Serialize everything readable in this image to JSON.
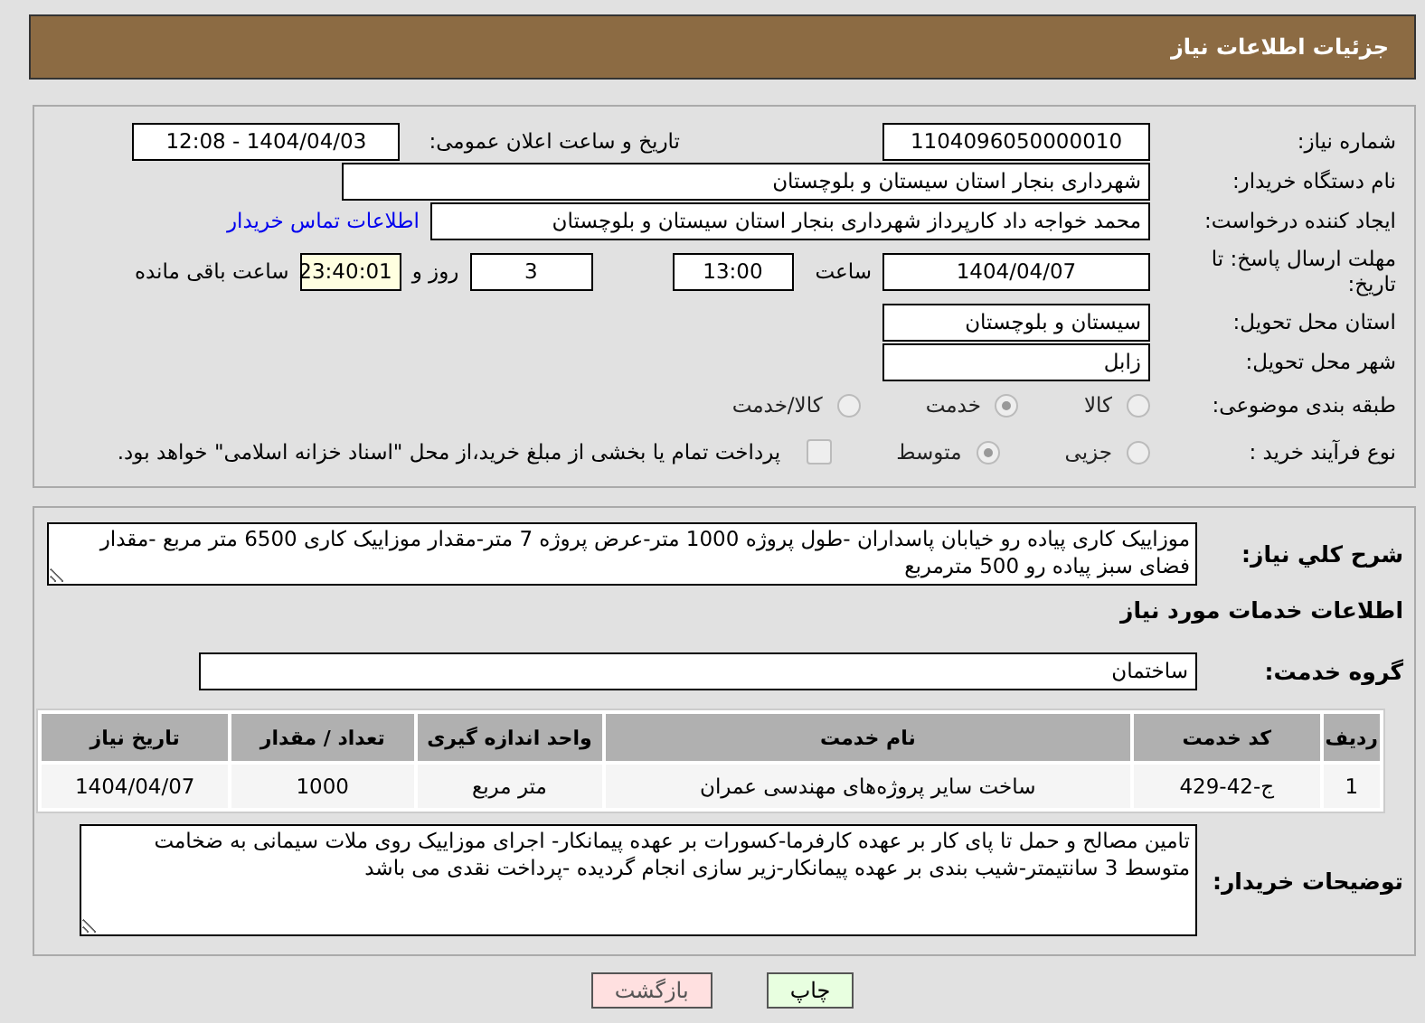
{
  "header": {
    "title": "جزئیات اطلاعات نیاز"
  },
  "need_number": {
    "label": "شماره نیاز:",
    "value": "1104096050000010"
  },
  "announce": {
    "label": "تاریخ و ساعت اعلان عمومی:",
    "value": "1404/04/03 - 12:08"
  },
  "buyer": {
    "label": "نام دستگاه خریدار:",
    "value": "شهرداری بنجار استان سیستان و بلوچستان"
  },
  "requester": {
    "label": "ایجاد کننده درخواست:",
    "value": "محمد خواجه داد کارپرداز شهرداری بنجار استان سیستان و بلوچستان",
    "link": "اطلاعات تماس خریدار"
  },
  "deadline": {
    "label": "مهلت ارسال پاسخ: تا تاریخ:",
    "date": "1404/04/07",
    "time_label": "ساعت",
    "time": "13:00",
    "days": "3",
    "days_label": "روز و",
    "remaining": "23:40:01",
    "remaining_label": "ساعت باقی مانده"
  },
  "province": {
    "label": "استان محل تحویل:",
    "value": "سیستان و بلوچستان"
  },
  "city": {
    "label": "شهر محل تحویل:",
    "value": "زابل"
  },
  "category": {
    "label": "طبقه بندی موضوعی:",
    "options": [
      {
        "label": "کالا",
        "selected": false
      },
      {
        "label": "خدمت",
        "selected": true
      },
      {
        "label": "کالا/خدمت",
        "selected": false
      }
    ]
  },
  "process": {
    "label": "نوع فرآیند خرید :",
    "options": [
      {
        "label": "جزیی",
        "selected": false
      },
      {
        "label": "متوسط",
        "selected": true
      }
    ],
    "payment": {
      "label": "پرداخت تمام یا بخشی از مبلغ خرید،از محل \"اسناد خزانه اسلامی\" خواهد بود.",
      "checked": false
    }
  },
  "description": {
    "label": "شرح کلي نياز:",
    "value": "موزاییک کاری پیاده رو خیابان پاسداران -طول پروژه 1000 متر-عرض پروژه 7 متر-مقدار موزاییک کاری 6500 متر مربع -مقدار فضای سبز پیاده رو 500 مترمربع"
  },
  "services_title": "اطلاعات خدمات مورد نياز",
  "service_group": {
    "label": "گروه خدمت:",
    "value": "ساختمان"
  },
  "table": {
    "columns": [
      "ردیف",
      "کد خدمت",
      "نام خدمت",
      "واحد اندازه گیری",
      "تعداد / مقدار",
      "تاریخ نیاز"
    ],
    "rows": [
      [
        "1",
        "ج-42-429",
        "ساخت سایر پروژه‌های مهندسی عمران",
        "متر مربع",
        "1000",
        "1404/04/07"
      ]
    ]
  },
  "buyer_notes": {
    "label": "توضیحات خریدار:",
    "value": "تامین مصالح و حمل تا پای کار بر عهده کارفرما-کسورات بر عهده پیمانکار- اجرای موزاییک روی ملات سیمانی به ضخامت متوسط 3 سانتیمتر-شیب بندی بر عهده پیمانکار-زیر سازی انجام گردیده -پرداخت نقدی می باشد"
  },
  "buttons": [
    {
      "label": "چاپ",
      "kind": "print"
    },
    {
      "label": "بازگشت",
      "kind": "back"
    }
  ]
}
